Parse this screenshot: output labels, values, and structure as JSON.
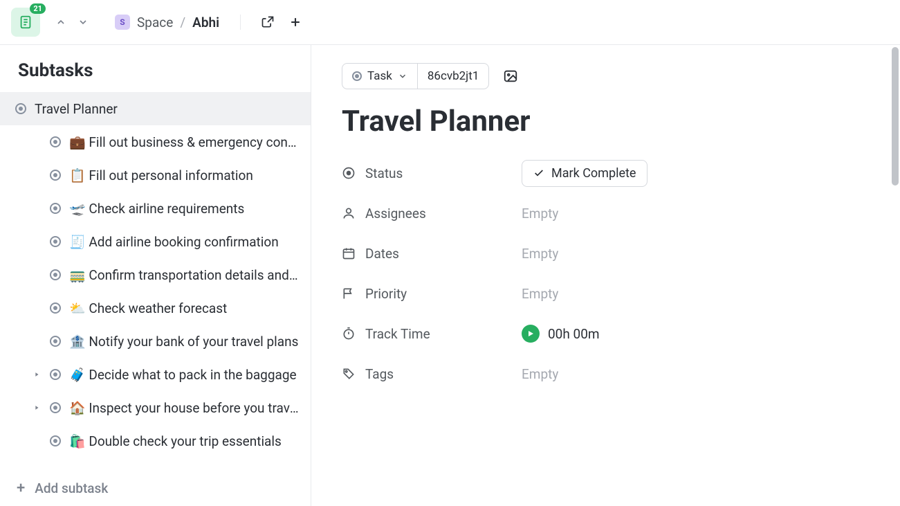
{
  "app": {
    "badge_count": "21"
  },
  "breadcrumb": {
    "space_letter": "S",
    "space": "Space",
    "separator": "/",
    "page": "Abhi"
  },
  "sidebar": {
    "title": "Subtasks",
    "add_label": "Add subtask",
    "items": [
      {
        "label": "Travel Planner",
        "selected": true,
        "child": false,
        "expandable": false
      },
      {
        "label": "💼 Fill out business & emergency contacts",
        "selected": false,
        "child": true,
        "expandable": false
      },
      {
        "label": "📋 Fill out personal information",
        "selected": false,
        "child": true,
        "expandable": false
      },
      {
        "label": "🛫 Check airline requirements",
        "selected": false,
        "child": true,
        "expandable": false
      },
      {
        "label": "🧾 Add airline booking confirmation",
        "selected": false,
        "child": true,
        "expandable": false
      },
      {
        "label": "🚃 Confirm transportation details and plan a route",
        "selected": false,
        "child": true,
        "expandable": false
      },
      {
        "label": "⛅ Check weather forecast",
        "selected": false,
        "child": true,
        "expandable": false
      },
      {
        "label": "🏦 Notify your bank of your travel plans",
        "selected": false,
        "child": true,
        "expandable": false
      },
      {
        "label": "🧳 Decide what to pack in the baggage",
        "selected": false,
        "child": true,
        "expandable": true
      },
      {
        "label": "🏠 Inspect your house before you travel",
        "selected": false,
        "child": true,
        "expandable": true
      },
      {
        "label": "🛍️ Double check your trip essentials",
        "selected": false,
        "child": true,
        "expandable": false
      }
    ]
  },
  "main": {
    "type_label": "Task",
    "task_id": "86cvb2jt1",
    "title": "Travel Planner",
    "status": {
      "label": "Status",
      "action": "Mark Complete"
    },
    "assignees": {
      "label": "Assignees",
      "value": "Empty"
    },
    "dates": {
      "label": "Dates",
      "value": "Empty"
    },
    "priority": {
      "label": "Priority",
      "value": "Empty"
    },
    "track": {
      "label": "Track Time",
      "value": "00h 00m"
    },
    "tags": {
      "label": "Tags",
      "value": "Empty"
    }
  }
}
